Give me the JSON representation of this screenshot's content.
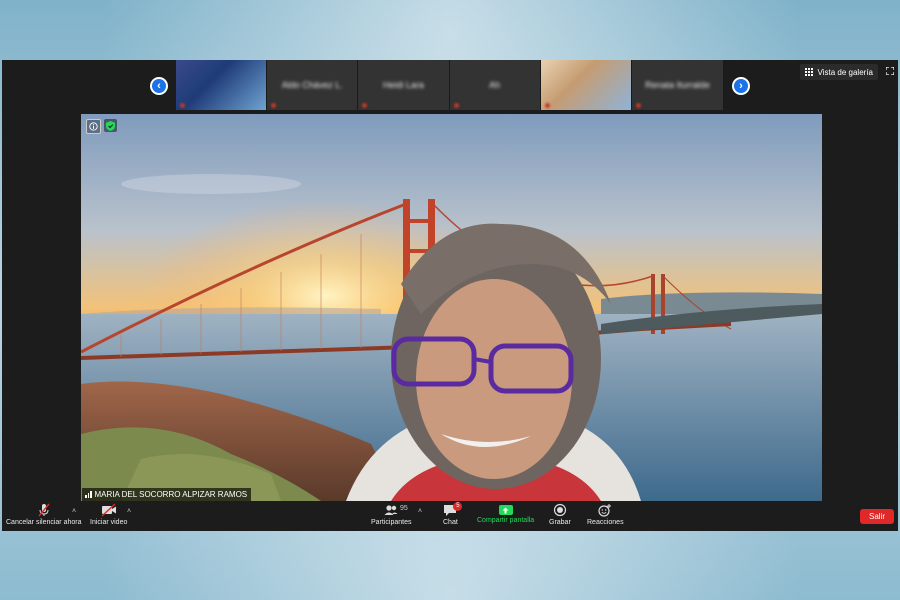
{
  "filmstrip": {
    "participants": [
      {
        "name": "",
        "has_photo": true
      },
      {
        "name": "Aldo Chávez L.",
        "has_photo": false
      },
      {
        "name": "Heidi Lara",
        "has_photo": false
      },
      {
        "name": "Ah",
        "has_photo": false
      },
      {
        "name": "",
        "has_photo": true
      },
      {
        "name": "Renata Iturralde",
        "has_photo": false
      }
    ]
  },
  "header": {
    "gallery_view_label": "Vista de galería"
  },
  "video": {
    "speaker_name": "MARIA DEL SOCORRO ALPIZAR RAMOS"
  },
  "toolbar": {
    "mute_label": "Cancelar silenciar ahora",
    "video_label": "Iniciar video",
    "participants_label": "Participantes",
    "participants_count": "95",
    "chat_label": "Chat",
    "chat_badge": "5",
    "share_label": "Compartir pantalla",
    "record_label": "Grabar",
    "reactions_label": "Reacciones",
    "leave_label": "Salir"
  },
  "colors": {
    "accent_blue": "#1a73e8",
    "share_green": "#23d959",
    "leave_red": "#e02828",
    "security_green": "#23d959"
  }
}
